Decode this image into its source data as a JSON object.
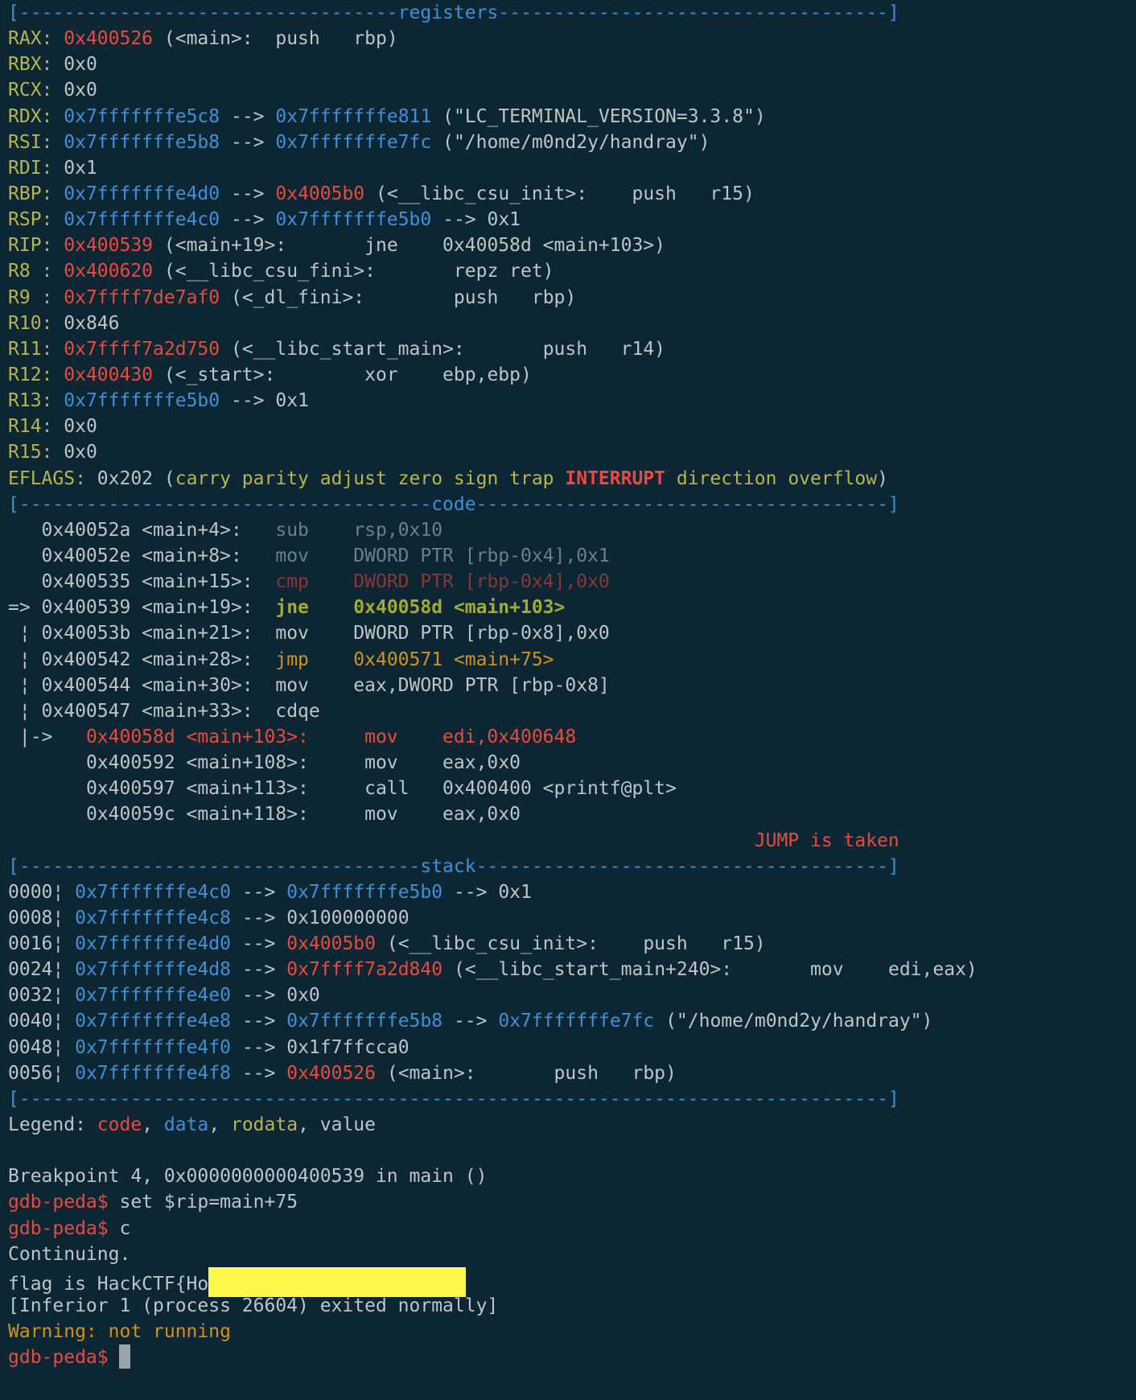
{
  "sections": {
    "registers": "[----------------------------------registers-----------------------------------]",
    "code": "[-------------------------------------code-------------------------------------]",
    "stack": "[------------------------------------stack-------------------------------------]",
    "end": "[------------------------------------------------------------------------------]"
  },
  "registers": {
    "rax": {
      "label": "RAX: ",
      "addr": "0x400526",
      "rest": " (<main>:\tpush   rbp)"
    },
    "rbx": {
      "label": "RBX: ",
      "value": "0x0"
    },
    "rcx": {
      "label": "RCX: ",
      "value": "0x0"
    },
    "rdx": {
      "label": "RDX: ",
      "a1": "0x7fffffffe5c8",
      "arrow": " --> ",
      "a2": "0x7fffffffe811",
      "rest": " (\"LC_TERMINAL_VERSION=3.3.8\")"
    },
    "rsi": {
      "label": "RSI: ",
      "a1": "0x7fffffffe5b8",
      "arrow": " --> ",
      "a2": "0x7fffffffe7fc",
      "rest": " (\"/home/m0nd2y/handray\")"
    },
    "rdi": {
      "label": "RDI: ",
      "value": "0x1"
    },
    "rbp": {
      "label": "RBP: ",
      "a1": "0x7fffffffe4d0",
      "arrow": " --> ",
      "a2": "0x4005b0",
      "rest": " (<__libc_csu_init>:    push   r15)"
    },
    "rsp": {
      "label": "RSP: ",
      "a1": "0x7fffffffe4c0",
      "arrow": " --> ",
      "a2": "0x7fffffffe5b0",
      "rest": " --> 0x1"
    },
    "rip": {
      "label": "RIP: ",
      "addr": "0x400539",
      "rest": " (<main+19>:       jne    0x40058d <main+103>)"
    },
    "r8": {
      "label": "R8 : ",
      "addr": "0x400620",
      "rest": " (<__libc_csu_fini>:       repz ret)"
    },
    "r9": {
      "label": "R9 : ",
      "addr": "0x7ffff7de7af0",
      "rest": " (<_dl_fini>:        push   rbp)"
    },
    "r10": {
      "label": "R10: ",
      "value": "0x846"
    },
    "r11": {
      "label": "R11: ",
      "addr": "0x7ffff7a2d750",
      "rest": " (<__libc_start_main>:       push   r14)"
    },
    "r12": {
      "label": "R12: ",
      "addr": "0x400430",
      "rest": " (<_start>:        xor    ebp,ebp)"
    },
    "r13": {
      "label": "R13: ",
      "a1": "0x7fffffffe5b0",
      "rest": " --> 0x1"
    },
    "r14": {
      "label": "R14: ",
      "value": "0x0"
    },
    "r15": {
      "label": "R15: ",
      "value": "0x0"
    }
  },
  "eflags": {
    "label": "EFLAGS: ",
    "value": "0x202 (",
    "flags_before": "carry parity adjust zero sign trap ",
    "flag_set": "INTERRUPT",
    "flags_after": " direction overflow",
    "close": ")"
  },
  "code": {
    "l1": {
      "prefix": "   0x40052a <main+4>:   ",
      "op": "sub    ",
      "args": "rsp,0x10"
    },
    "l2": {
      "prefix": "   0x40052e <main+8>:   ",
      "op": "mov    ",
      "args": "DWORD PTR [rbp-0x4],0x1"
    },
    "l3": {
      "prefix": "   0x400535 <main+15>:  ",
      "op": "cmp    ",
      "args": "DWORD PTR [rbp-0x4],0x0"
    },
    "l4": {
      "prefix": "=> 0x400539 <main+19>:  ",
      "op": "jne    ",
      "args": "0x40058d <main+103>"
    },
    "l5": {
      "prefix": " ¦ 0x40053b <main+21>:  ",
      "op": "mov    ",
      "args": "DWORD PTR [rbp-0x8],0x0"
    },
    "l6": {
      "prefix": " ¦ 0x400542 <main+28>:  ",
      "op": "jmp    ",
      "args": "0x400571 <main+75>"
    },
    "l7": {
      "prefix": " ¦ 0x400544 <main+30>:  ",
      "op": "mov    ",
      "args": "eax,DWORD PTR [rbp-0x8]"
    },
    "l8": {
      "prefix": " ¦ 0x400547 <main+33>:  ",
      "op": "cdqe",
      "args": ""
    },
    "l9": {
      "prefix": " |->   ",
      "text": "0x40058d <main+103>:     mov    edi,0x400648"
    },
    "l10": {
      "prefix": "       ",
      "text": "0x400592 <main+108>:     mov    eax,0x0"
    },
    "l11": {
      "prefix": "       ",
      "text": "0x400597 <main+113>:     call   0x400400 <printf@plt>"
    },
    "l12": {
      "prefix": "       ",
      "text": "0x40059c <main+118>:     mov    eax,0x0"
    },
    "jump_pad": "                                                                   ",
    "jump_status": "JUMP is taken"
  },
  "stack": {
    "s0": {
      "off": "0000¦ ",
      "a1": "0x7fffffffe4c0",
      "arrow": " --> ",
      "a2": "0x7fffffffe5b0",
      "rest": " --> 0x1"
    },
    "s1": {
      "off": "0008¦ ",
      "a1": "0x7fffffffe4c8",
      "arrow": " --> ",
      "rest": "0x100000000"
    },
    "s2": {
      "off": "0016¦ ",
      "a1": "0x7fffffffe4d0",
      "arrow": " --> ",
      "a2": "0x4005b0",
      "rest": " (<__libc_csu_init>:    push   r15)"
    },
    "s3": {
      "off": "0024¦ ",
      "a1": "0x7fffffffe4d8",
      "arrow": " --> ",
      "a2": "0x7ffff7a2d840",
      "rest": " (<__libc_start_main+240>:       mov    edi,eax)"
    },
    "s4": {
      "off": "0032¦ ",
      "a1": "0x7fffffffe4e0",
      "arrow": " --> ",
      "rest": "0x0"
    },
    "s5": {
      "off": "0040¦ ",
      "a1": "0x7fffffffe4e8",
      "arrow": " --> ",
      "a2": "0x7fffffffe5b8",
      "arrow2": " --> ",
      "a3": "0x7fffffffe7fc",
      "rest": " (\"/home/m0nd2y/handray\")"
    },
    "s6": {
      "off": "0048¦ ",
      "a1": "0x7fffffffe4f0",
      "arrow": " --> ",
      "rest": "0x1f7ffcca0"
    },
    "s7": {
      "off": "0056¦ ",
      "a1": "0x7fffffffe4f8",
      "arrow": " --> ",
      "a2": "0x400526",
      "rest": " (<main>:       push   rbp)"
    }
  },
  "legend": {
    "label": "Legend: ",
    "code": "code",
    "sep": ", ",
    "data": "data",
    "rodata": "rodata",
    "value": "value"
  },
  "output": {
    "breakpoint": "Breakpoint 4, 0x0000000000400539 in main ()",
    "prompt": "gdb-peda$ ",
    "cmd1": "set $rip=main+75",
    "cmd2": "c",
    "continuing": "Continuing.",
    "flag_prefix": "flag is HackCTF{Ho",
    "inferior": "[Inferior 1 (process 26604) exited normally]",
    "warning": "Warning: not running"
  }
}
